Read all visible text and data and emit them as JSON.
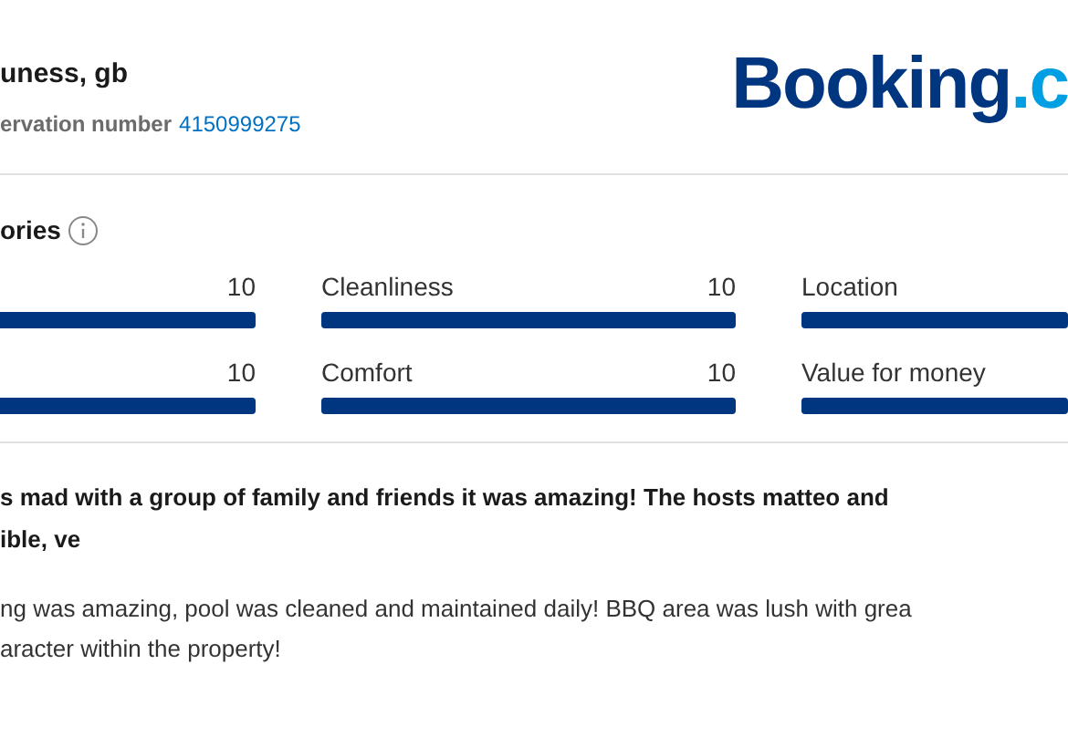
{
  "header": {
    "guest": "uness, gb",
    "reservation_label": "ervation number",
    "reservation_number": "4150999275",
    "logo": {
      "wordmark": "Booking",
      "suffix": ".c"
    }
  },
  "categories": {
    "title": "ories",
    "items": [
      {
        "score": "10",
        "level": 1
      },
      {
        "label": "Cleanliness",
        "score": "10",
        "level": 1
      },
      {
        "label": "Location",
        "level": 1
      },
      {
        "score": "10",
        "level": 1
      },
      {
        "label": "Comfort",
        "score": "10",
        "level": 1
      },
      {
        "label": "Value for money",
        "level": 1
      }
    ]
  },
  "review": {
    "title_lines": [
      "s mad with a group of family and friends it was amazing! The hosts matteo and",
      "ible, ve"
    ],
    "body_lines": [
      "ng was amazing, pool was cleaned and maintained daily! BBQ area was lush with grea",
      "aracter within the property!"
    ]
  }
}
